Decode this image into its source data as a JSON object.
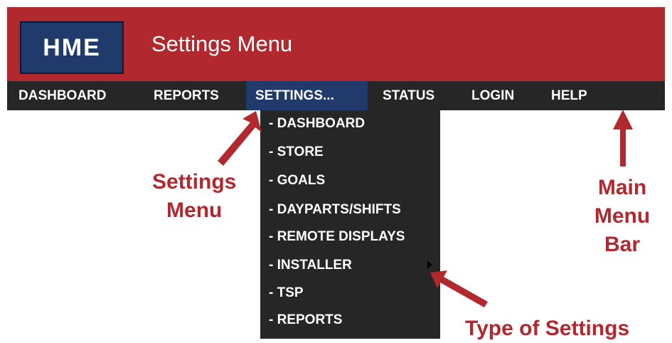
{
  "header": {
    "logo_text": "HME",
    "title": "Settings Menu"
  },
  "menubar": {
    "items": [
      {
        "label": "DASHBOARD"
      },
      {
        "label": "REPORTS"
      },
      {
        "label": "SETTINGS..."
      },
      {
        "label": "STATUS"
      },
      {
        "label": "LOGIN"
      },
      {
        "label": "HELP"
      }
    ],
    "active": "SETTINGS..."
  },
  "dropdown": {
    "items": [
      {
        "label": "- DASHBOARD"
      },
      {
        "label": "- STORE"
      },
      {
        "label": "- GOALS"
      },
      {
        "label": "- DAYPARTS/SHIFTS"
      },
      {
        "label": "- REMOTE DISPLAYS"
      },
      {
        "label": "- INSTALLER",
        "has_submenu": true
      },
      {
        "label": "- TSP"
      },
      {
        "label": "- REPORTS"
      }
    ]
  },
  "annotations": {
    "settings_menu": {
      "line1": "Settings",
      "line2": "Menu"
    },
    "main_menu_bar": {
      "line1": "Main",
      "line2": "Menu",
      "line3": "Bar"
    },
    "type_of_settings": "Type of Settings"
  },
  "colors": {
    "header_red": "#b1282e",
    "logo_blue": "#1f3a6b",
    "menubar_dark": "#262626",
    "annotation_red": "#b1282e"
  }
}
